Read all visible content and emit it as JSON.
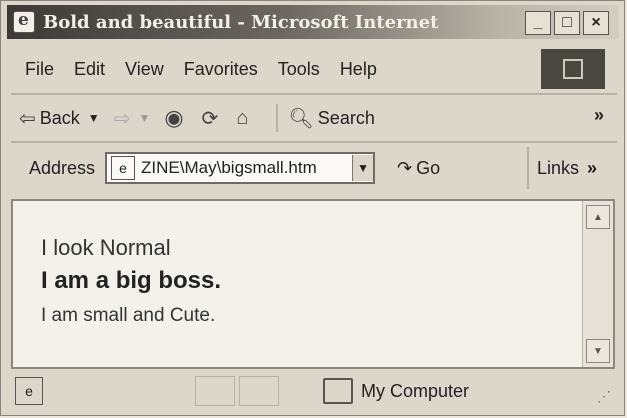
{
  "window": {
    "title": "Bold and beautiful - Microsoft Internet",
    "controls": {
      "minimize": "_",
      "maximize": "□",
      "close": "×"
    }
  },
  "menu": {
    "items": [
      {
        "label": "File"
      },
      {
        "label": "Edit"
      },
      {
        "label": "View"
      },
      {
        "label": "Favorites"
      },
      {
        "label": "Tools"
      },
      {
        "label": "Help"
      }
    ]
  },
  "toolbar": {
    "back_label": "Back",
    "search_label": "Search",
    "more_label": "»"
  },
  "address_bar": {
    "label": "Address",
    "value": "ZINE\\May\\bigsmall.htm",
    "go_label": "Go",
    "links_label": "Links",
    "links_more": "»"
  },
  "content": {
    "line_normal": "I look Normal",
    "line_big": "I am a big boss.",
    "line_small": "I am small and Cute."
  },
  "status": {
    "zone_label": "My Computer"
  }
}
